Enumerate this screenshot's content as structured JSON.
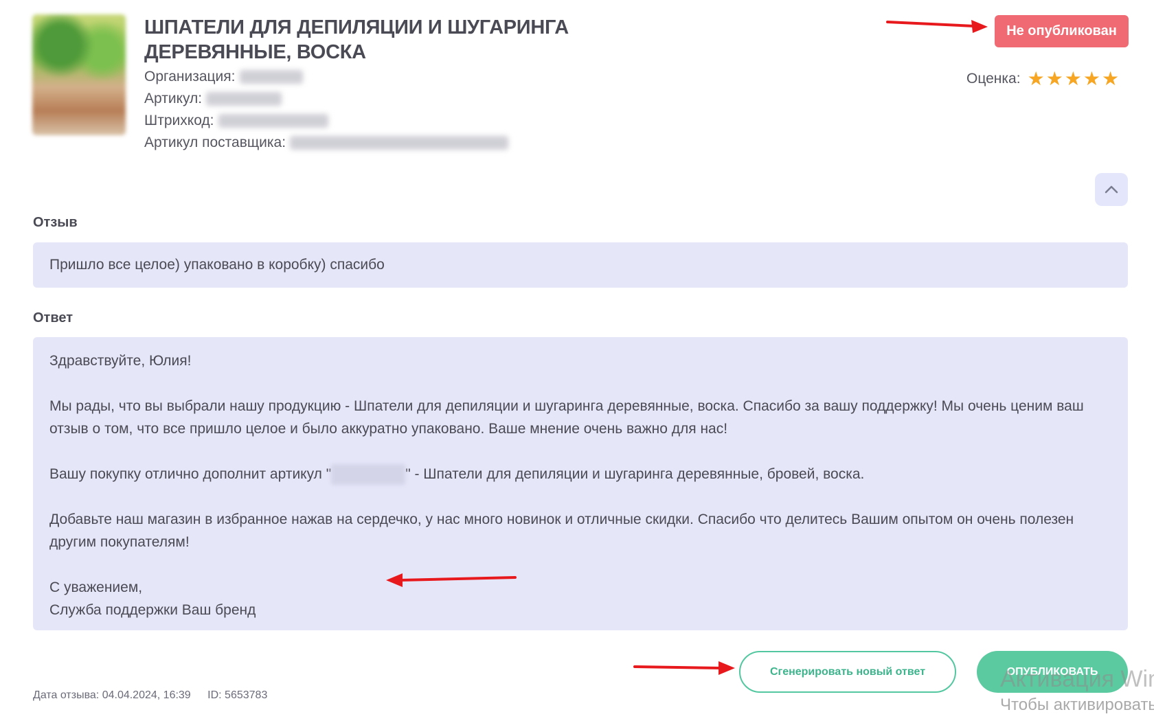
{
  "product": {
    "title": "ШПАТЕЛИ ДЛЯ ДЕПИЛЯЦИИ И ШУГАРИНГА ДЕРЕВЯННЫЕ, ВОСКА",
    "organization_label": "Организация:",
    "article_label": "Артикул:",
    "barcode_label": "Штрихкод:",
    "supplier_article_label": "Артикул поставщика:"
  },
  "status": {
    "label": "Не опубликован",
    "color": "#f06a73"
  },
  "rating": {
    "label": "Оценка:",
    "value": 5,
    "max": 5
  },
  "review": {
    "label": "Отзыв",
    "text": "Пришло все целое) упаковано в коробку) спасибо"
  },
  "answer": {
    "label": "Ответ",
    "greeting": "Здравствуйте, Юлия!",
    "paragraph1": "Мы рады, что вы выбрали нашу продукцию - Шпатели для депиляции и шугаринга деревянные, воска. Спасибо за вашу поддержку! Мы очень ценим ваш отзыв о том, что все пришло целое и было аккуратно упаковано. Ваше мнение очень важно для нас!",
    "paragraph2_before": "Вашу покупку отлично дополнит артикул \"",
    "paragraph2_after": "\" - Шпатели для депиляции и шугаринга деревянные, бровей, воска.",
    "paragraph3": "Добавьте наш магазин в избранное нажав на сердечко, у нас много новинок и отличные скидки. Спасибо что делитесь Вашим опытом он очень полезен другим покупателям!",
    "closing": "С уважением,",
    "signature": "Служба поддержки Ваш бренд"
  },
  "actions": {
    "generate_label": "Сгенерировать новый ответ",
    "publish_label": "опубликовать"
  },
  "footer": {
    "date": "Дата отзыва: 04.04.2024, 16:39",
    "id": "ID: 5653783"
  },
  "watermark": {
    "line1": "Активация Win",
    "line2": "Чтобы активировать"
  },
  "colors": {
    "accent": "#5ccaa0",
    "panel": "#e6e6f9",
    "star": "#f6a623",
    "arrow": "#e8191c"
  }
}
